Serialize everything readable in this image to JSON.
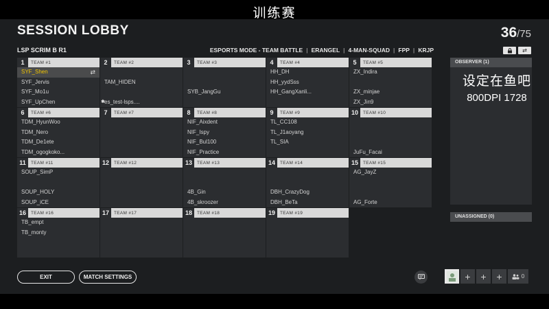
{
  "overlay": {
    "top_text": "训练赛",
    "side_line1": "设定在鱼吧",
    "side_line2": "800DPI 1728"
  },
  "header": {
    "title": "SESSION LOBBY",
    "subtitle": "LSP SCRIM B R1",
    "count_current": "36",
    "count_separator": "/",
    "count_max": "75",
    "mode_items": [
      "ESPORTS MODE - TEAM BATTLE",
      "ERANGEL",
      "4-MAN-SQUAD",
      "FPP",
      "KRJP"
    ]
  },
  "icons": {
    "lock": "lock-icon",
    "swap": "swap-icon",
    "chat": "chat-icon",
    "add": "plus-icon",
    "users": "users-icon"
  },
  "teams": [
    {
      "num": "1",
      "name": "TEAM #1",
      "players": [
        "SYF_Shen",
        "SYF_Jervis",
        "SYF_Mo1u",
        "SYF_UpChen"
      ]
    },
    {
      "num": "2",
      "name": "TEAM #2",
      "players": [
        "",
        "TAM_HIDEN",
        "",
        "es_test-lsps...."
      ]
    },
    {
      "num": "3",
      "name": "TEAM #3",
      "players": [
        "",
        "",
        "SYB_JangGu",
        ""
      ]
    },
    {
      "num": "4",
      "name": "TEAM #4",
      "players": [
        "HH_DH",
        "HH_yydSss",
        "HH_GangXanli...",
        ""
      ]
    },
    {
      "num": "5",
      "name": "TEAM #5",
      "players": [
        "ZX_Indira",
        "",
        "ZX_minjae",
        "ZX_Jin9"
      ]
    },
    {
      "num": "6",
      "name": "TEAM #6",
      "players": [
        "TDM_HyunWoo",
        "TDM_Nero",
        "TDM_De1ete",
        "TDM_ogogkoko..."
      ]
    },
    {
      "num": "7",
      "name": "TEAM #7",
      "players": [
        "",
        "",
        "",
        ""
      ]
    },
    {
      "num": "8",
      "name": "TEAM #8",
      "players": [
        "NIF_Aixdent",
        "NIF_Ispy",
        "NIF_Bul100",
        "NIF_Practice"
      ]
    },
    {
      "num": "9",
      "name": "TEAM #9",
      "players": [
        "TL_CC108",
        "TL_J1aoyang",
        "TL_SIA",
        ""
      ]
    },
    {
      "num": "10",
      "name": "TEAM #10",
      "players": [
        "",
        "",
        "",
        "JuFu_Facai"
      ]
    },
    {
      "num": "11",
      "name": "TEAM #11",
      "players": [
        "SOUP_SimP",
        "",
        "SOUP_HOLY",
        "SOUP_iCE"
      ]
    },
    {
      "num": "12",
      "name": "TEAM #12",
      "players": [
        "",
        "",
        "",
        ""
      ]
    },
    {
      "num": "13",
      "name": "TEAM #13",
      "players": [
        "",
        "",
        "4B_Gin",
        "4B_skroozer"
      ]
    },
    {
      "num": "14",
      "name": "TEAM #14",
      "players": [
        "",
        "",
        "DBH_CrazyDog",
        "DBH_BeTa"
      ]
    },
    {
      "num": "15",
      "name": "TEAM #15",
      "players": [
        "AG_JayZ",
        "",
        "",
        "AG_Forte"
      ]
    },
    {
      "num": "16",
      "name": "TEAM #16",
      "players": [
        "TB_empt",
        "TB_monty",
        "",
        ""
      ]
    },
    {
      "num": "17",
      "name": "TEAM #17",
      "players": [
        "",
        "",
        "",
        ""
      ]
    },
    {
      "num": "18",
      "name": "TEAM #18",
      "players": [
        "",
        "",
        "",
        ""
      ]
    },
    {
      "num": "19",
      "name": "TEAM #19",
      "players": [
        "",
        "",
        "",
        ""
      ]
    }
  ],
  "observer": {
    "label": "OBSERVER (1)"
  },
  "unassigned": {
    "label": "UNASSIGNED (0)"
  },
  "buttons": {
    "exit": "EXIT",
    "match_settings": "MATCH SETTINGS"
  },
  "party": {
    "count": "0"
  },
  "colors": {
    "highlight_name": "#f0c400",
    "panel": "#2b2d30",
    "header": "#d9d9d9",
    "background": "#1c1e20"
  }
}
